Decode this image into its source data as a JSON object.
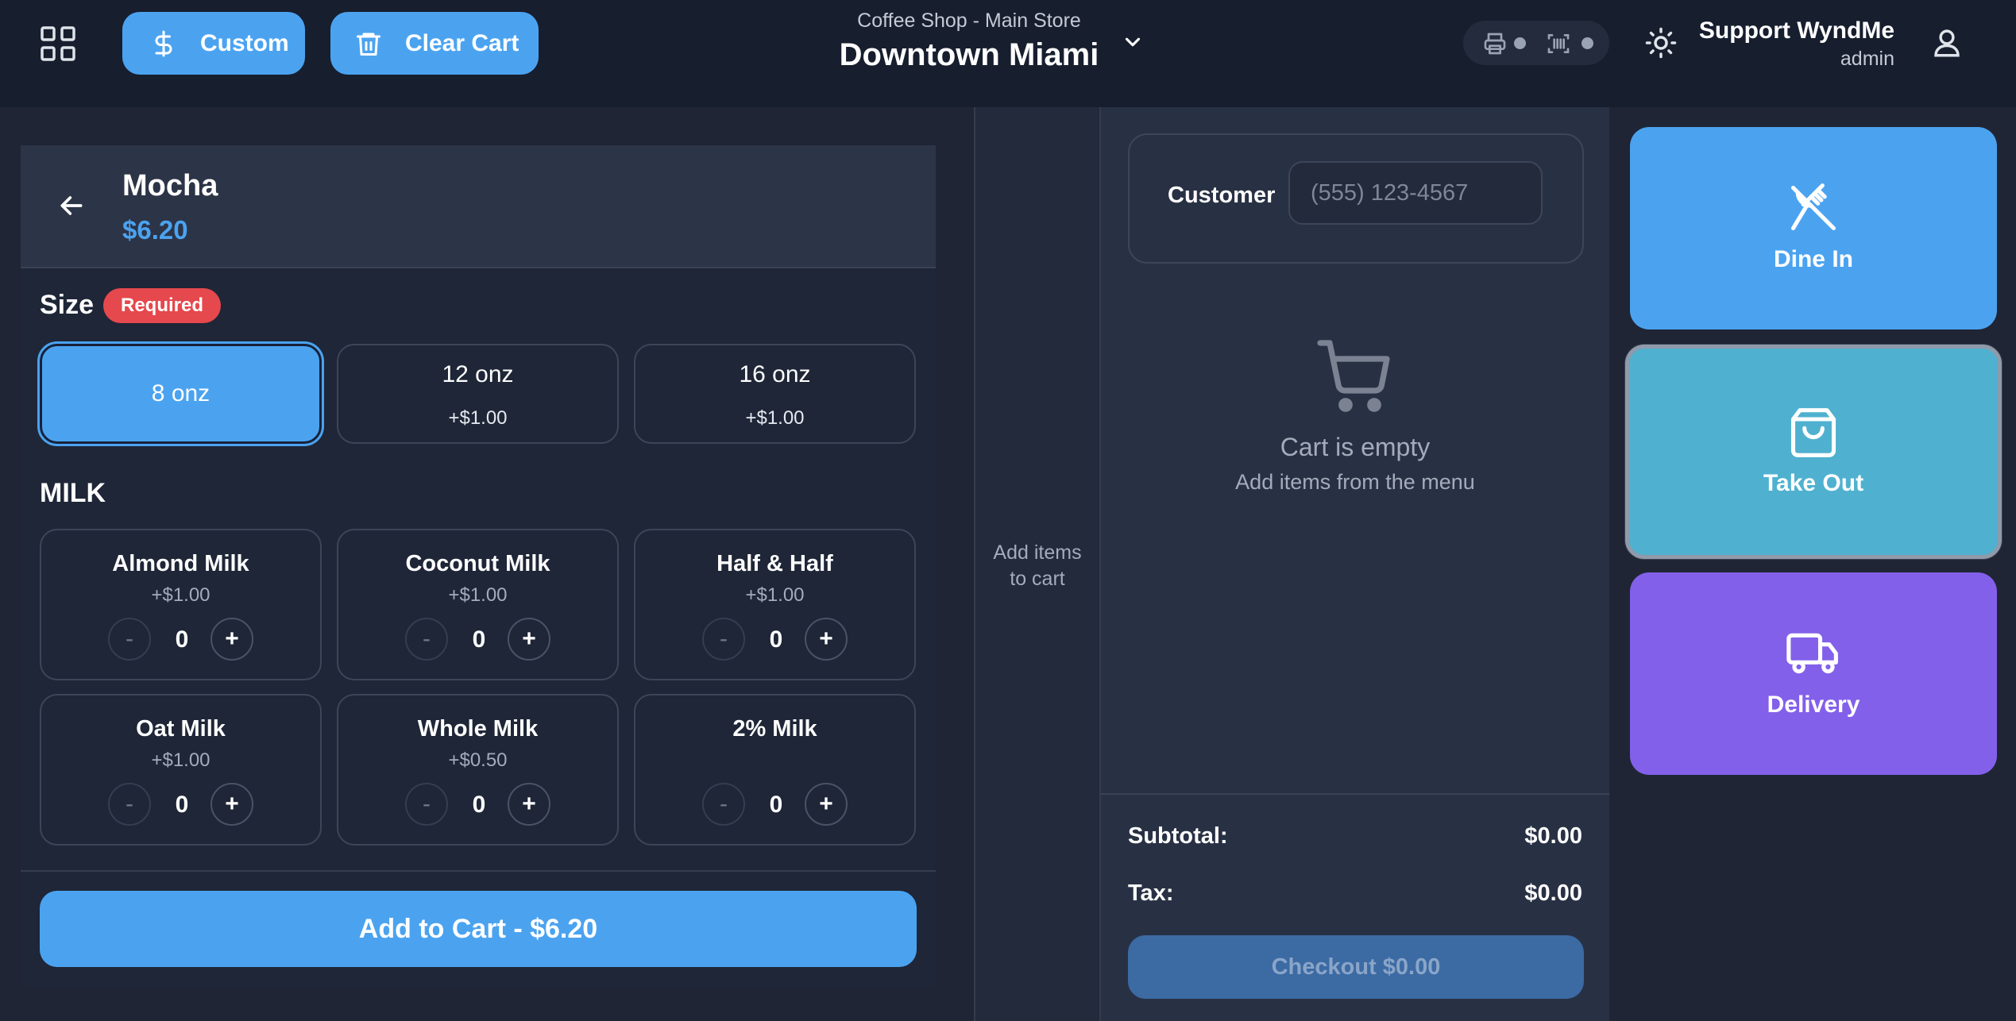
{
  "header": {
    "custom_label": "Custom",
    "clear_cart_label": "Clear Cart",
    "store_subtitle": "Coffee Shop - Main Store",
    "store_name": "Downtown Miami",
    "user_name": "Support WyndMe",
    "user_role": "admin"
  },
  "product": {
    "name": "Mocha",
    "price": "$6.20",
    "size_title": "Size",
    "required_badge": "Required",
    "sizes": [
      {
        "label": "8 onz",
        "extra": "",
        "selected": true
      },
      {
        "label": "12 onz",
        "extra": "+$1.00"
      },
      {
        "label": "16 onz",
        "extra": "+$1.00"
      }
    ],
    "milk_title": "MILK",
    "milk_options": [
      {
        "name": "Almond Milk",
        "price": "+$1.00",
        "qty": "0"
      },
      {
        "name": "Coconut Milk",
        "price": "+$1.00",
        "qty": "0"
      },
      {
        "name": "Half & Half",
        "price": "+$1.00",
        "qty": "0"
      },
      {
        "name": "Oat Milk",
        "price": "+$1.00",
        "qty": "0"
      },
      {
        "name": "Whole Milk",
        "price": "+$0.50",
        "qty": "0"
      },
      {
        "name": "2% Milk",
        "price": "",
        "qty": "0"
      }
    ],
    "minus_symbol": "-",
    "plus_symbol": "+",
    "add_to_cart_label": "Add to Cart - $6.20"
  },
  "hint": {
    "text": "Add items\nto cart"
  },
  "cart": {
    "customer_label": "Customer",
    "customer_placeholder": "(555) 123-4567",
    "customer_value": "",
    "empty_title": "Cart is empty",
    "empty_hint": "Add items from the menu",
    "subtotal_label": "Subtotal:",
    "subtotal_value": "$0.00",
    "tax_label": "Tax:",
    "tax_value": "$0.00",
    "checkout_label": "Checkout $0.00"
  },
  "order_types": {
    "dine_in": "Dine In",
    "take_out": "Take Out",
    "delivery": "Delivery"
  },
  "colors": {
    "accent": "#4ba3f0",
    "take_out": "#4fb1cf",
    "delivery": "#8360ea",
    "required": "#e5484d",
    "background": "#1f2535"
  },
  "icons": [
    "grid-icon",
    "dollar-icon",
    "trash-icon",
    "chevron-down-icon",
    "printer-icon",
    "barcode-scanner-icon",
    "sun-icon",
    "user-icon",
    "back-arrow-icon",
    "cart-icon",
    "utensils-icon",
    "shopping-bag-icon",
    "truck-icon"
  ]
}
